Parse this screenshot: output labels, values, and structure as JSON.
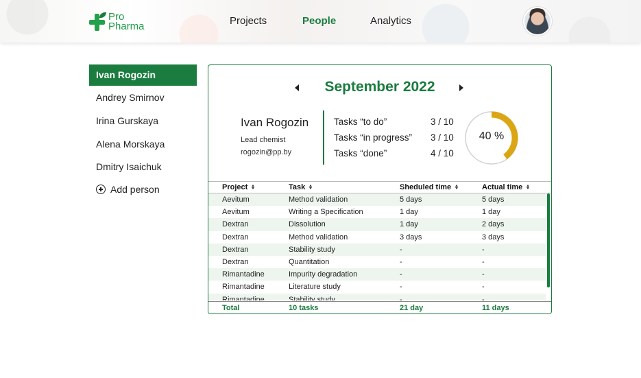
{
  "brand": {
    "line1": "Pro",
    "line2": "Pharma",
    "color": "#22a04b"
  },
  "nav": {
    "items": [
      {
        "label": "Projects",
        "active": false
      },
      {
        "label": "People",
        "active": true
      },
      {
        "label": "Analytics",
        "active": false
      }
    ]
  },
  "sidebar": {
    "people": [
      "Ivan Rogozin",
      "Andrey Smirnov",
      "Irina Gurskaya",
      "Alena Morskaya",
      "Dmitry Isaichuk"
    ],
    "add_label": "Add person"
  },
  "calendar": {
    "month": "September 2022"
  },
  "employee": {
    "name": "Ivan Rogozin",
    "role": "Lead chemist",
    "email": "rogozin@pp.by"
  },
  "stats": [
    {
      "label": "Tasks “to do”",
      "value": "3 / 10"
    },
    {
      "label": "Tasks “in progress”",
      "value": "3 / 10"
    },
    {
      "label": "Tasks “done”",
      "value": "4 / 10"
    }
  ],
  "progress": {
    "percent": 40,
    "label": "40 %",
    "color": "#dba614",
    "track": "#d0d0d0"
  },
  "table": {
    "headers": [
      "Project",
      "Task",
      "Sheduled time",
      "Actual time"
    ],
    "rows": [
      [
        "Aevitum",
        "Method validation",
        "5 days",
        "5 days"
      ],
      [
        "Aevitum",
        "Writing a Specification",
        "1 day",
        "1 day"
      ],
      [
        "Dextran",
        "Dissolution",
        "1 day",
        "2 days"
      ],
      [
        "Dextran",
        "Method validation",
        "3 days",
        "3 days"
      ],
      [
        "Dextran",
        "Stability study",
        "-",
        "-"
      ],
      [
        "Dextran",
        "Quantitation",
        "-",
        "-"
      ],
      [
        "Rimantadine",
        "Impurity degradation",
        "-",
        "-"
      ],
      [
        "Rimantadine",
        "Literature study",
        "-",
        "-"
      ],
      [
        "Rimantadine",
        "Stability study",
        "-",
        "-"
      ]
    ],
    "footer": [
      "Total",
      "10 tasks",
      "21 day",
      "11 days"
    ]
  },
  "accent_color": "#1a7c3e"
}
